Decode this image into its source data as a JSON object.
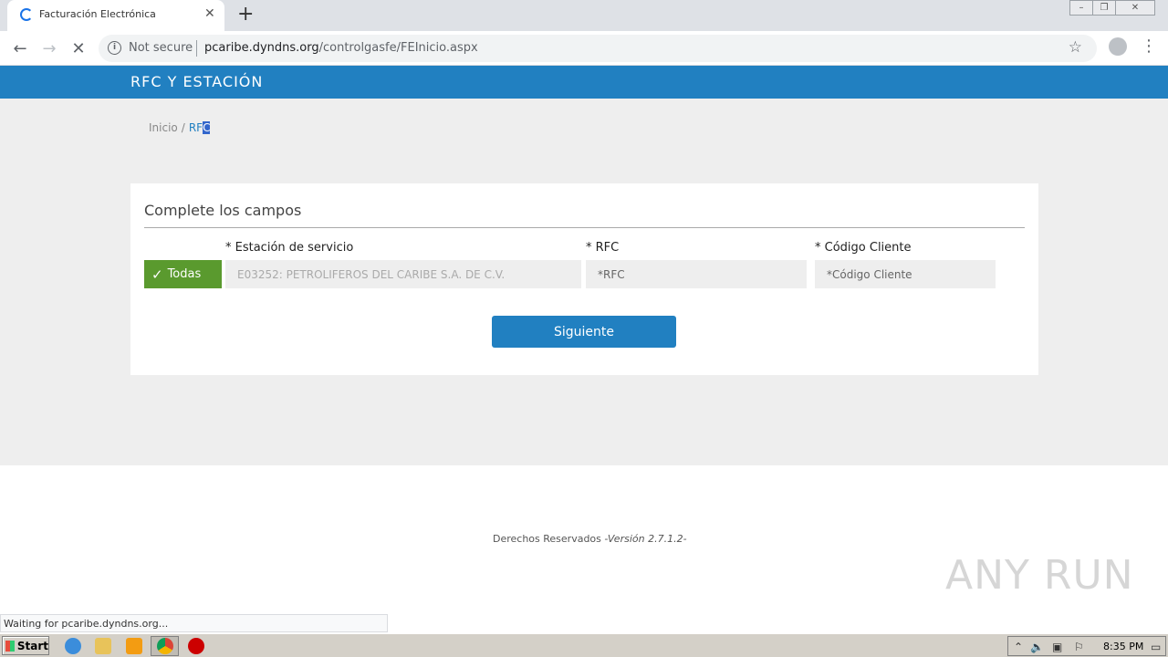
{
  "browser": {
    "tab_title": "Facturación Electrónica",
    "not_secure": "Not secure",
    "url_host": "pcaribe.dyndns.org",
    "url_path": "/controlgasfe/FEInicio.aspx",
    "status_text": "Waiting for pcaribe.dyndns.org..."
  },
  "header": {
    "title": "RFC Y ESTACIÓN"
  },
  "breadcrumb": {
    "home": "Inicio",
    "separator": "/",
    "current_a": "RF",
    "current_b": "C"
  },
  "form": {
    "title": "Complete los campos",
    "todas_label": "Todas",
    "station_label": "* Estación de servicio",
    "station_value": "E03252: PETROLIFEROS DEL CARIBE S.A. DE C.V.",
    "rfc_label": "* RFC",
    "rfc_placeholder": "*RFC",
    "codigo_label": "* Código Cliente",
    "codigo_placeholder": "*Código Cliente",
    "submit_label": "Siguiente"
  },
  "footer": {
    "rights": "Derechos Reservados ",
    "version": "-Versión 2.7.1.2-"
  },
  "watermark": "ANY RUN",
  "taskbar": {
    "start_label": "Start",
    "clock": "8:35 PM"
  },
  "colors": {
    "brand_blue": "#2180c1",
    "todas_green": "#5a9a2e"
  }
}
